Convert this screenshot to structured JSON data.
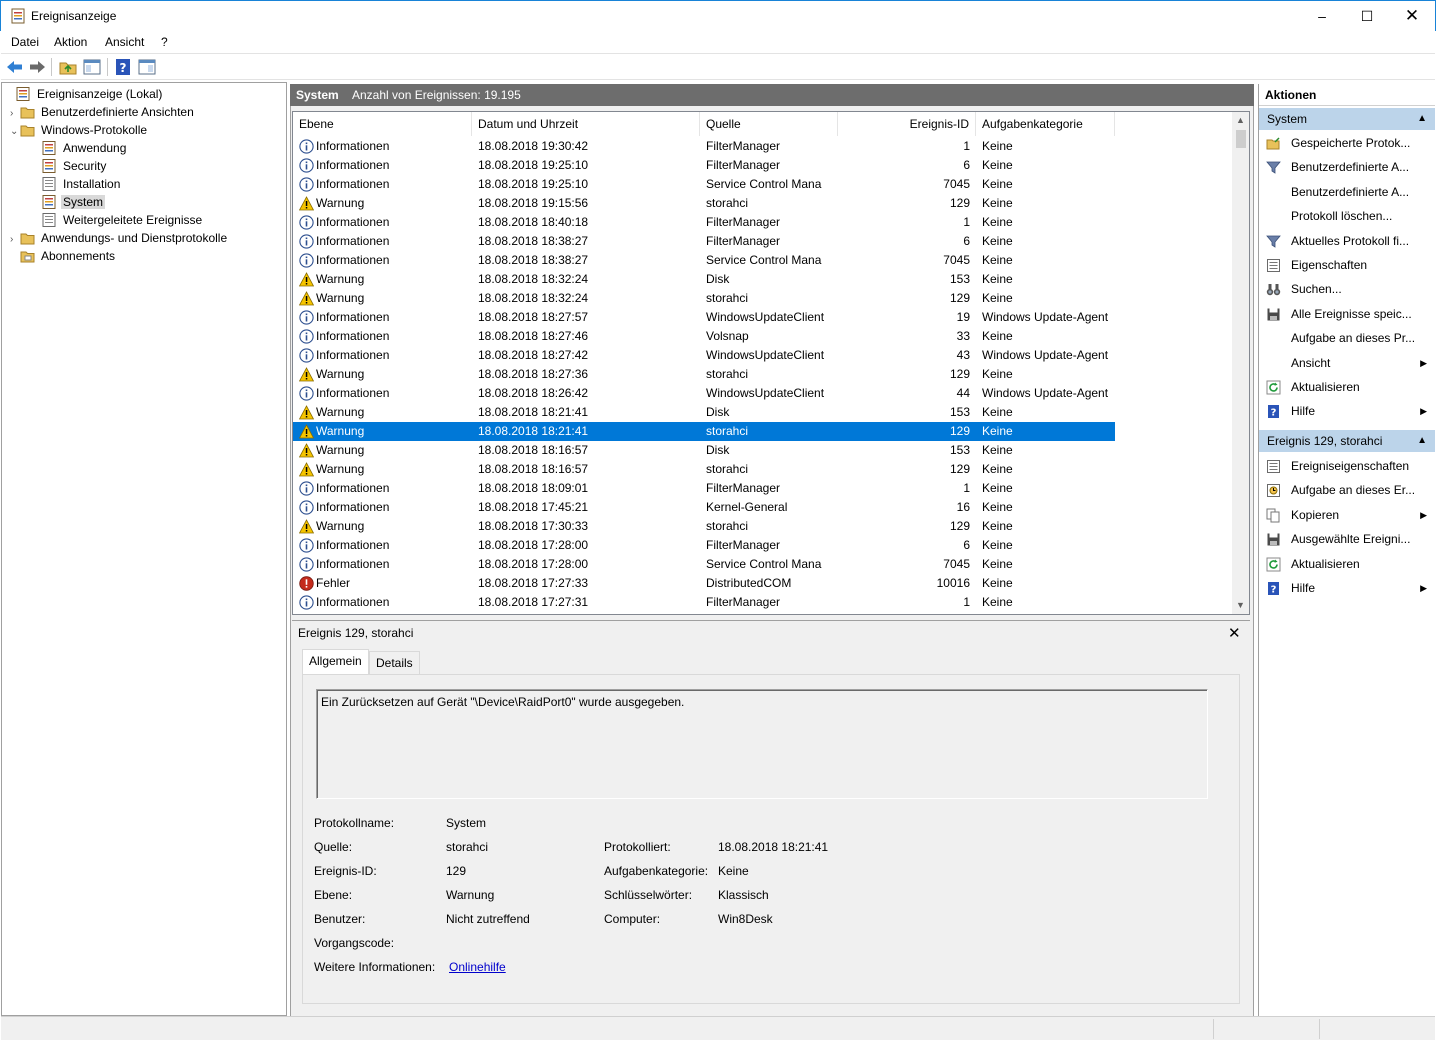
{
  "window": {
    "title": "Ereignisanzeige"
  },
  "menu": [
    {
      "label": "Datei"
    },
    {
      "label": "Aktion"
    },
    {
      "label": "Ansicht"
    },
    {
      "label": "?"
    }
  ],
  "tree": {
    "root": "Ereignisanzeige (Lokal)",
    "custom_views": "Benutzerdefinierte Ansichten",
    "windows_logs": "Windows-Protokolle",
    "logs": [
      "Anwendung",
      "Security",
      "Installation",
      "System",
      "Weitergeleitete Ereignisse"
    ],
    "app_service_logs": "Anwendungs- und Dienstprotokolle",
    "subscriptions": "Abonnements"
  },
  "center": {
    "log_name": "System",
    "count_text": "Anzahl von Ereignissen: 19.195"
  },
  "grid": {
    "columns": [
      "Ebene",
      "Datum und Uhrzeit",
      "Quelle",
      "Ereignis-ID",
      "Aufgabenkategorie"
    ],
    "rows": [
      {
        "level": "Informationen",
        "icon": "info-icon",
        "date": "18.08.2018 19:30:42",
        "source": "FilterManager",
        "id": "1",
        "category": "Keine"
      },
      {
        "level": "Informationen",
        "icon": "info-icon",
        "date": "18.08.2018 19:25:10",
        "source": "FilterManager",
        "id": "6",
        "category": "Keine"
      },
      {
        "level": "Informationen",
        "icon": "info-icon",
        "date": "18.08.2018 19:25:10",
        "source": "Service Control Mana",
        "id": "7045",
        "category": "Keine"
      },
      {
        "level": "Warnung",
        "icon": "warning-icon",
        "date": "18.08.2018 19:15:56",
        "source": "storahci",
        "id": "129",
        "category": "Keine"
      },
      {
        "level": "Informationen",
        "icon": "info-icon",
        "date": "18.08.2018 18:40:18",
        "source": "FilterManager",
        "id": "1",
        "category": "Keine"
      },
      {
        "level": "Informationen",
        "icon": "info-icon",
        "date": "18.08.2018 18:38:27",
        "source": "FilterManager",
        "id": "6",
        "category": "Keine"
      },
      {
        "level": "Informationen",
        "icon": "info-icon",
        "date": "18.08.2018 18:38:27",
        "source": "Service Control Mana",
        "id": "7045",
        "category": "Keine"
      },
      {
        "level": "Warnung",
        "icon": "warning-icon",
        "date": "18.08.2018 18:32:24",
        "source": "Disk",
        "id": "153",
        "category": "Keine"
      },
      {
        "level": "Warnung",
        "icon": "warning-icon",
        "date": "18.08.2018 18:32:24",
        "source": "storahci",
        "id": "129",
        "category": "Keine"
      },
      {
        "level": "Informationen",
        "icon": "info-icon",
        "date": "18.08.2018 18:27:57",
        "source": "WindowsUpdateClient",
        "id": "19",
        "category": "Windows Update-Agent"
      },
      {
        "level": "Informationen",
        "icon": "info-icon",
        "date": "18.08.2018 18:27:46",
        "source": "Volsnap",
        "id": "33",
        "category": "Keine"
      },
      {
        "level": "Informationen",
        "icon": "info-icon",
        "date": "18.08.2018 18:27:42",
        "source": "WindowsUpdateClient",
        "id": "43",
        "category": "Windows Update-Agent"
      },
      {
        "level": "Warnung",
        "icon": "warning-icon",
        "date": "18.08.2018 18:27:36",
        "source": "storahci",
        "id": "129",
        "category": "Keine"
      },
      {
        "level": "Informationen",
        "icon": "info-icon",
        "date": "18.08.2018 18:26:42",
        "source": "WindowsUpdateClient",
        "id": "44",
        "category": "Windows Update-Agent"
      },
      {
        "level": "Warnung",
        "icon": "warning-icon",
        "date": "18.08.2018 18:21:41",
        "source": "Disk",
        "id": "153",
        "category": "Keine"
      },
      {
        "level": "Warnung",
        "icon": "warning-icon",
        "date": "18.08.2018 18:21:41",
        "source": "storahci",
        "id": "129",
        "category": "Keine",
        "selected": true
      },
      {
        "level": "Warnung",
        "icon": "warning-icon",
        "date": "18.08.2018 18:16:57",
        "source": "Disk",
        "id": "153",
        "category": "Keine"
      },
      {
        "level": "Warnung",
        "icon": "warning-icon",
        "date": "18.08.2018 18:16:57",
        "source": "storahci",
        "id": "129",
        "category": "Keine"
      },
      {
        "level": "Informationen",
        "icon": "info-icon",
        "date": "18.08.2018 18:09:01",
        "source": "FilterManager",
        "id": "1",
        "category": "Keine"
      },
      {
        "level": "Informationen",
        "icon": "info-icon",
        "date": "18.08.2018 17:45:21",
        "source": "Kernel-General",
        "id": "16",
        "category": "Keine"
      },
      {
        "level": "Warnung",
        "icon": "warning-icon",
        "date": "18.08.2018 17:30:33",
        "source": "storahci",
        "id": "129",
        "category": "Keine"
      },
      {
        "level": "Informationen",
        "icon": "info-icon",
        "date": "18.08.2018 17:28:00",
        "source": "FilterManager",
        "id": "6",
        "category": "Keine"
      },
      {
        "level": "Informationen",
        "icon": "info-icon",
        "date": "18.08.2018 17:28:00",
        "source": "Service Control Mana",
        "id": "7045",
        "category": "Keine"
      },
      {
        "level": "Fehler",
        "icon": "error-icon",
        "date": "18.08.2018 17:27:33",
        "source": "DistributedCOM",
        "id": "10016",
        "category": "Keine"
      },
      {
        "level": "Informationen",
        "icon": "info-icon",
        "date": "18.08.2018 17:27:31",
        "source": "FilterManager",
        "id": "1",
        "category": "Keine"
      }
    ]
  },
  "detail": {
    "title": "Ereignis 129, storahci",
    "tabs": [
      "Allgemein",
      "Details"
    ],
    "message": "Ein Zurücksetzen auf Gerät \"\\Device\\RaidPort0\" wurde ausgegeben.",
    "fields": {
      "log_name_label": "Protokollname:",
      "log_name": "System",
      "source_label": "Quelle:",
      "source": "storahci",
      "logged_label": "Protokolliert:",
      "logged": "18.08.2018 18:21:41",
      "event_id_label": "Ereignis-ID:",
      "event_id": "129",
      "task_label": "Aufgabenkategorie:",
      "task": "Keine",
      "level_label": "Ebene:",
      "level": "Warnung",
      "keywords_label": "Schlüsselwörter:",
      "keywords": "Klassisch",
      "user_label": "Benutzer:",
      "user": "Nicht zutreffend",
      "computer_label": "Computer:",
      "computer": "Win8Desk",
      "opcode_label": "Vorgangscode:",
      "more_info_label": "Weitere Informationen:",
      "more_info_link": "Onlinehilfe"
    }
  },
  "actions": {
    "header": "Aktionen",
    "group1": "System",
    "group1_items": [
      {
        "label": "Gespeicherte Protok...",
        "icon": "open-folder-icon"
      },
      {
        "label": "Benutzerdefinierte A...",
        "icon": "filter-icon"
      },
      {
        "label": "Benutzerdefinierte A...",
        "icon": ""
      },
      {
        "label": "Protokoll löschen...",
        "icon": ""
      },
      {
        "label": "Aktuelles Protokoll fi...",
        "icon": "filter-icon"
      },
      {
        "label": "Eigenschaften",
        "icon": "properties-icon"
      },
      {
        "label": "Suchen...",
        "icon": "binoculars-icon"
      },
      {
        "label": "Alle Ereignisse speic...",
        "icon": "save-icon"
      },
      {
        "label": "Aufgabe an dieses Pr...",
        "icon": ""
      },
      {
        "label": "Ansicht",
        "icon": "",
        "submenu": true
      },
      {
        "label": "Aktualisieren",
        "icon": "refresh-icon"
      },
      {
        "label": "Hilfe",
        "icon": "help-icon",
        "submenu": true
      }
    ],
    "group2": "Ereignis 129, storahci",
    "group2_items": [
      {
        "label": "Ereigniseigenschaften",
        "icon": "properties-icon"
      },
      {
        "label": "Aufgabe an dieses Er...",
        "icon": "task-icon"
      },
      {
        "label": "Kopieren",
        "icon": "copy-icon",
        "submenu": true
      },
      {
        "label": "Ausgewählte Ereigni...",
        "icon": "save-icon"
      },
      {
        "label": "Aktualisieren",
        "icon": "refresh-icon"
      },
      {
        "label": "Hilfe",
        "icon": "help-icon",
        "submenu": true
      }
    ]
  }
}
